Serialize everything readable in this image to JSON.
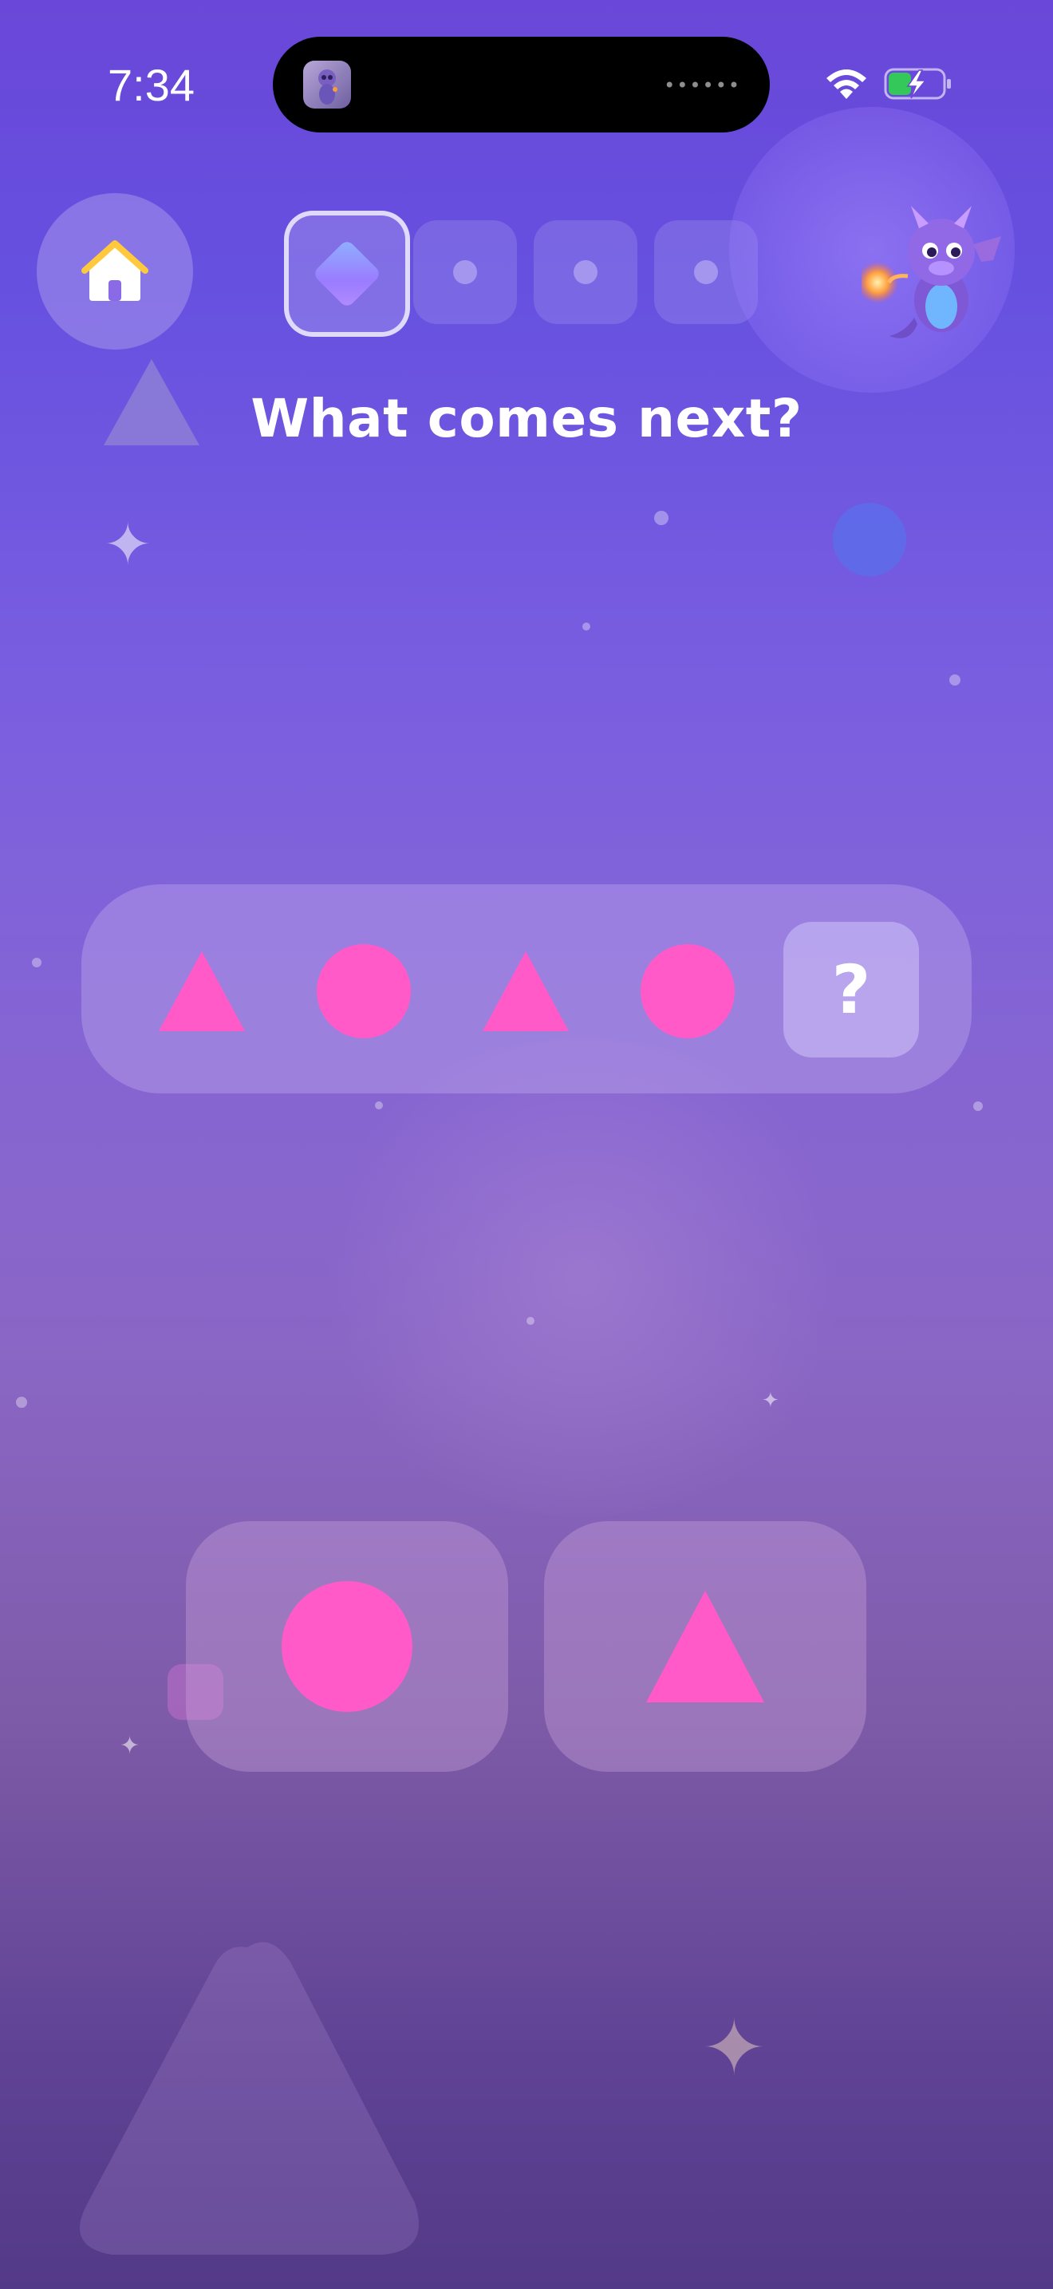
{
  "status_bar": {
    "time": "7:34",
    "island_dots": "••••••"
  },
  "header": {
    "home_icon": "house-icon",
    "progress_total": 4,
    "progress_current": 1,
    "mascot_icon": "dragon-mascot"
  },
  "question": {
    "title": "What comes next?"
  },
  "sequence": {
    "items": [
      "triangle",
      "circle",
      "triangle",
      "circle"
    ],
    "unknown_label": "?"
  },
  "answers": [
    {
      "shape": "circle"
    },
    {
      "shape": "triangle"
    }
  ],
  "colors": {
    "shape_pink": "#ff5ac8",
    "accent_purple": "#7a5ee0"
  }
}
